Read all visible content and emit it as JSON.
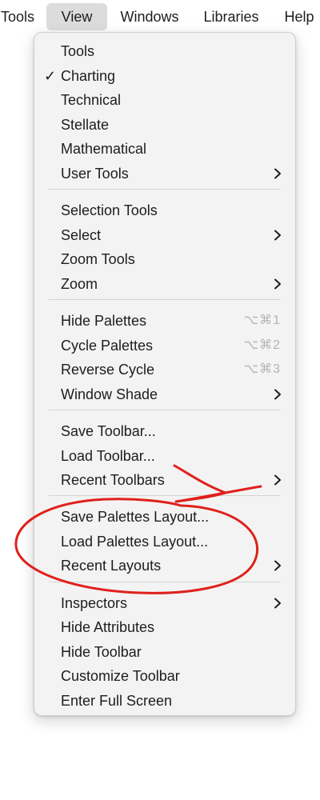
{
  "menubar": {
    "items": [
      "Tools",
      "View",
      "Windows",
      "Libraries",
      "Help"
    ],
    "active_index": 1
  },
  "menu": {
    "checkmark": "✓",
    "groups": [
      {
        "items": [
          {
            "label": "Tools"
          },
          {
            "label": "Charting",
            "checked": true
          },
          {
            "label": "Technical"
          },
          {
            "label": "Stellate"
          },
          {
            "label": "Mathematical"
          },
          {
            "label": "User Tools",
            "submenu": true
          }
        ]
      },
      {
        "items": [
          {
            "label": "Selection Tools"
          },
          {
            "label": "Select",
            "submenu": true
          },
          {
            "label": "Zoom Tools"
          },
          {
            "label": "Zoom",
            "submenu": true
          }
        ]
      },
      {
        "items": [
          {
            "label": "Hide Palettes",
            "shortcut": "⌥⌘1"
          },
          {
            "label": "Cycle Palettes",
            "shortcut": "⌥⌘2"
          },
          {
            "label": "Reverse Cycle",
            "shortcut": "⌥⌘3"
          },
          {
            "label": "Window Shade",
            "submenu": true
          }
        ]
      },
      {
        "items": [
          {
            "label": "Save Toolbar..."
          },
          {
            "label": "Load Toolbar..."
          },
          {
            "label": "Recent Toolbars",
            "submenu": true
          }
        ]
      },
      {
        "items": [
          {
            "label": "Save Palettes Layout..."
          },
          {
            "label": "Load Palettes Layout..."
          },
          {
            "label": "Recent Layouts",
            "submenu": true
          }
        ]
      },
      {
        "items": [
          {
            "label": "Inspectors",
            "submenu": true
          },
          {
            "label": "Hide Attributes"
          },
          {
            "label": "Hide Toolbar"
          },
          {
            "label": "Customize Toolbar"
          },
          {
            "label": "Enter Full Screen"
          }
        ]
      }
    ]
  },
  "annotation": {
    "color": "#e0201b",
    "shapes": [
      "circle-around-palettes-layout-items",
      "strike-through-recent-toolbars"
    ]
  },
  "colors": {
    "menu_background": "#f3f3f3",
    "active_menubar_background": "#dcdcdc",
    "shortcut_text": "#b4b4b8",
    "annotation_red": "#e0201b"
  }
}
